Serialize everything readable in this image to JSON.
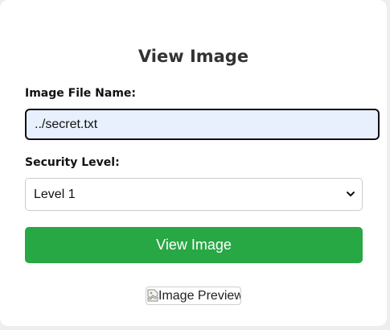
{
  "page": {
    "title": "View Image"
  },
  "form": {
    "filename_label": "Image File Name:",
    "filename_value": "../secret.txt",
    "security_label": "Security Level:",
    "security_selected": "Level 1",
    "submit_label": "View Image"
  },
  "preview": {
    "alt_text": "Image Preview"
  },
  "colors": {
    "button": "#28a745",
    "input_background": "#e8f0fe"
  },
  "icons": {
    "select_arrow": "chevron-down-icon",
    "broken_image": "broken-image-icon"
  }
}
